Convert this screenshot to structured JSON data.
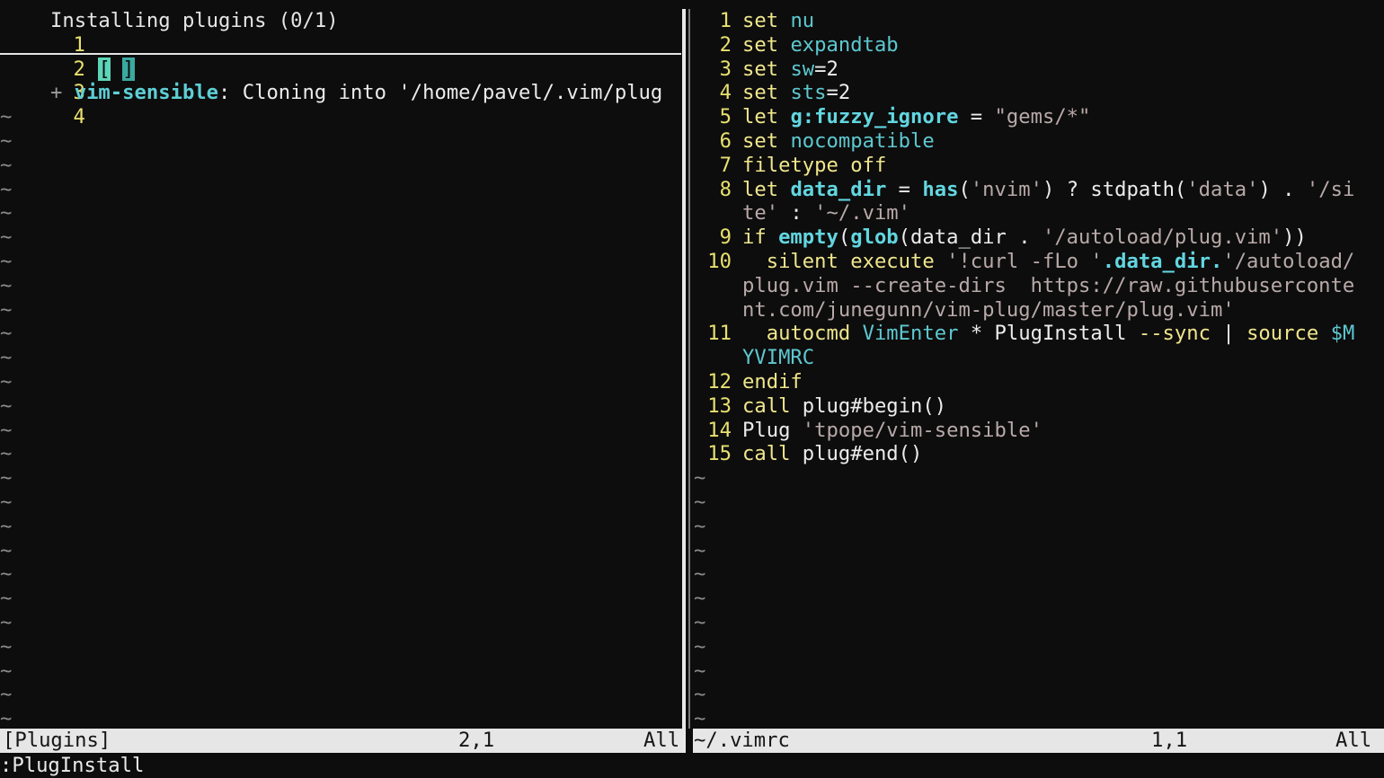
{
  "left_buffer": {
    "lines": [
      {
        "num": "1",
        "text": "Installing plugins (0/1)"
      },
      {
        "num": "2",
        "bracket_open": "[",
        "bracket_close": "]"
      },
      {
        "num": "3",
        "text": ""
      },
      {
        "num": "4",
        "plus": "+",
        "plugin": "vim-sensible",
        "rest": ": Cloning into '/home/pavel/.vim/plug"
      }
    ],
    "tilde": "~"
  },
  "right_buffer": {
    "lines": [
      {
        "num": "1",
        "parts": [
          {
            "c": "kw",
            "t": "set "
          },
          {
            "c": "id",
            "t": "nu"
          }
        ]
      },
      {
        "num": "2",
        "parts": [
          {
            "c": "kw",
            "t": "set "
          },
          {
            "c": "id",
            "t": "expandtab"
          }
        ]
      },
      {
        "num": "3",
        "parts": [
          {
            "c": "kw",
            "t": "set "
          },
          {
            "c": "id",
            "t": "sw"
          },
          {
            "c": "plain",
            "t": "=2"
          }
        ]
      },
      {
        "num": "4",
        "parts": [
          {
            "c": "kw",
            "t": "set "
          },
          {
            "c": "id",
            "t": "sts"
          },
          {
            "c": "plain",
            "t": "=2"
          }
        ]
      },
      {
        "num": "5",
        "parts": [
          {
            "c": "kw",
            "t": "let "
          },
          {
            "c": "idb",
            "t": "g:fuzzy_ignore"
          },
          {
            "c": "plain",
            "t": " = "
          },
          {
            "c": "str",
            "t": "\"gems/*\""
          }
        ]
      },
      {
        "num": "6",
        "parts": [
          {
            "c": "kw",
            "t": "set "
          },
          {
            "c": "id",
            "t": "nocompatible"
          }
        ]
      },
      {
        "num": "7",
        "parts": [
          {
            "c": "kw",
            "t": "filetype off"
          }
        ]
      },
      {
        "num": "8",
        "parts": [
          {
            "c": "kw",
            "t": "let "
          },
          {
            "c": "idb",
            "t": "data_dir"
          },
          {
            "c": "plain",
            "t": " = "
          },
          {
            "c": "idb",
            "t": "has"
          },
          {
            "c": "plain",
            "t": "("
          },
          {
            "c": "str",
            "t": "'nvim'"
          },
          {
            "c": "plain",
            "t": ") ? stdpath("
          },
          {
            "c": "str",
            "t": "'data'"
          },
          {
            "c": "plain",
            "t": ") . "
          },
          {
            "c": "str",
            "t": "'/si"
          }
        ]
      },
      {
        "num": "",
        "parts": [
          {
            "c": "str",
            "t": "te'"
          },
          {
            "c": "plain",
            "t": " : "
          },
          {
            "c": "str",
            "t": "'~/.vim'"
          }
        ]
      },
      {
        "num": "9",
        "parts": [
          {
            "c": "kw",
            "t": "if "
          },
          {
            "c": "idb",
            "t": "empty"
          },
          {
            "c": "plain",
            "t": "("
          },
          {
            "c": "idb",
            "t": "glob"
          },
          {
            "c": "plain",
            "t": "(data_dir . "
          },
          {
            "c": "str",
            "t": "'/autoload/plug.vim'"
          },
          {
            "c": "plain",
            "t": "))"
          }
        ]
      },
      {
        "num": "10",
        "parts": [
          {
            "c": "kw",
            "t": "  silent execute "
          },
          {
            "c": "str",
            "t": "'!curl -fLo '"
          },
          {
            "c": "idb",
            "t": ".data_dir."
          },
          {
            "c": "str",
            "t": "'/autoload/"
          }
        ]
      },
      {
        "num": "",
        "parts": [
          {
            "c": "str",
            "t": "plug.vim --create-dirs  https://raw.githubuserconte"
          }
        ]
      },
      {
        "num": "",
        "parts": [
          {
            "c": "str",
            "t": "nt.com/junegunn/vim-plug/master/plug.vim'"
          }
        ]
      },
      {
        "num": "11",
        "parts": [
          {
            "c": "kw",
            "t": "  autocmd "
          },
          {
            "c": "id",
            "t": "VimEnter"
          },
          {
            "c": "plain",
            "t": " * PlugInstall "
          },
          {
            "c": "kw",
            "t": "--sync"
          },
          {
            "c": "plain",
            "t": " | "
          },
          {
            "c": "kw",
            "t": "source "
          },
          {
            "c": "id",
            "t": "$M"
          }
        ]
      },
      {
        "num": "",
        "parts": [
          {
            "c": "id",
            "t": "YVIMRC"
          }
        ]
      },
      {
        "num": "12",
        "parts": [
          {
            "c": "kw",
            "t": "endif"
          }
        ]
      },
      {
        "num": "13",
        "parts": [
          {
            "c": "kw",
            "t": "call "
          },
          {
            "c": "plain",
            "t": "plug#begin()"
          }
        ]
      },
      {
        "num": "14",
        "parts": [
          {
            "c": "plain",
            "t": "Plug "
          },
          {
            "c": "str",
            "t": "'tpope/vim-sensible'"
          }
        ]
      },
      {
        "num": "15",
        "parts": [
          {
            "c": "kw",
            "t": "call "
          },
          {
            "c": "plain",
            "t": "plug#end()"
          }
        ]
      }
    ],
    "tilde": "~"
  },
  "status": {
    "left_name": "[Plugins]",
    "left_pos": "2,1",
    "left_scroll": "All",
    "right_name": "~/.vimrc",
    "right_pos": "1,1",
    "right_scroll": "All"
  },
  "cmdline": ":PlugInstall",
  "colors": {
    "background": "#0d0d0d",
    "line_number": "#e8e070",
    "keyword": "#f0e68c",
    "identifier": "#5ec8d0",
    "string": "#b9a9a9",
    "status_bg": "#e6e6e6",
    "cursor": "#5bd6b8"
  }
}
